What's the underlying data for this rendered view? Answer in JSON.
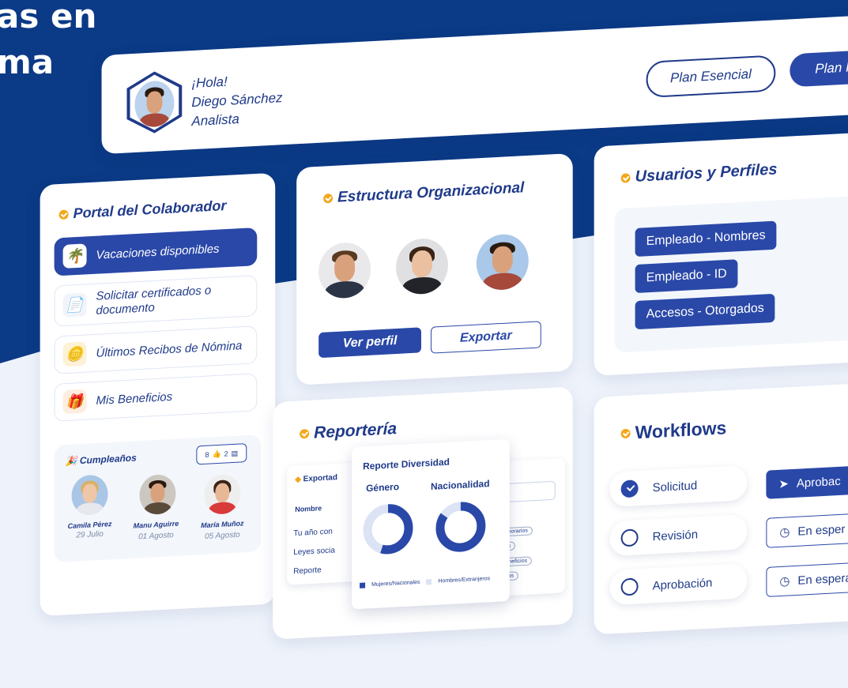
{
  "hero": {
    "line1": "as en",
    "line2": "ma"
  },
  "header": {
    "greeting": "¡Hola!",
    "name": "Diego Sánchez",
    "role": "Analista",
    "plan_esencial": "Plan Esencial",
    "plan_second": "Plan I"
  },
  "portal": {
    "title": "Portal del Colaborador",
    "items": [
      {
        "label": "Vacaciones disponibles",
        "icon": "palm-tree-icon"
      },
      {
        "label": "Solicitar certificados o documento",
        "icon": "document-icon"
      },
      {
        "label": "Últimos Recibos de Nómina",
        "icon": "coins-icon"
      },
      {
        "label": "Mis Beneficios",
        "icon": "gift-icon"
      }
    ],
    "birthdays": {
      "title": "Cumpleaños",
      "likes": "8",
      "comments": "2",
      "people": [
        {
          "name": "Camila Pérez",
          "date": "29 Julio"
        },
        {
          "name": "Manu Aguirre",
          "date": "01 Agosto"
        },
        {
          "name": "María Muñoz",
          "date": "05 Agosto"
        }
      ]
    }
  },
  "estructura": {
    "title": "Estructura Organizacional",
    "ver_perfil": "Ver perfil",
    "exportar": "Exportar"
  },
  "usuarios": {
    "title": "Usuarios y Perfiles",
    "tags": [
      "Empleado - Nombres",
      "Empleado - ID",
      "Accesos - Otorgados"
    ]
  },
  "reporteria": {
    "title": "Reportería",
    "back_title": "Exportad",
    "back_col": "Nombre",
    "back_rows": [
      "Tu año con",
      "Leyes socia",
      "Reporte"
    ],
    "right_tags": [
      "honorarios",
      "nes",
      "Beneficios",
      "fetas"
    ],
    "report_title": "Reporte Diversidad",
    "genero": "Género",
    "nacionalidad": "Nacionalidad",
    "legend1": "Mujeres/Nacionales",
    "legend2": "Hombres/Extranjeros",
    "chart_data": {
      "genero_dark_pct": 55,
      "nacionalidad_dark_pct": 85
    }
  },
  "workflows": {
    "title": "Workflows",
    "steps": [
      "Solicitud",
      "Revisión",
      "Aprobación"
    ],
    "aprobar": "Aprobac",
    "espera1": "En esper",
    "espera2": "En espera"
  },
  "colors": {
    "navy": "#0b3a86",
    "accent": "#2a48a8",
    "orange": "#f2a81d"
  }
}
